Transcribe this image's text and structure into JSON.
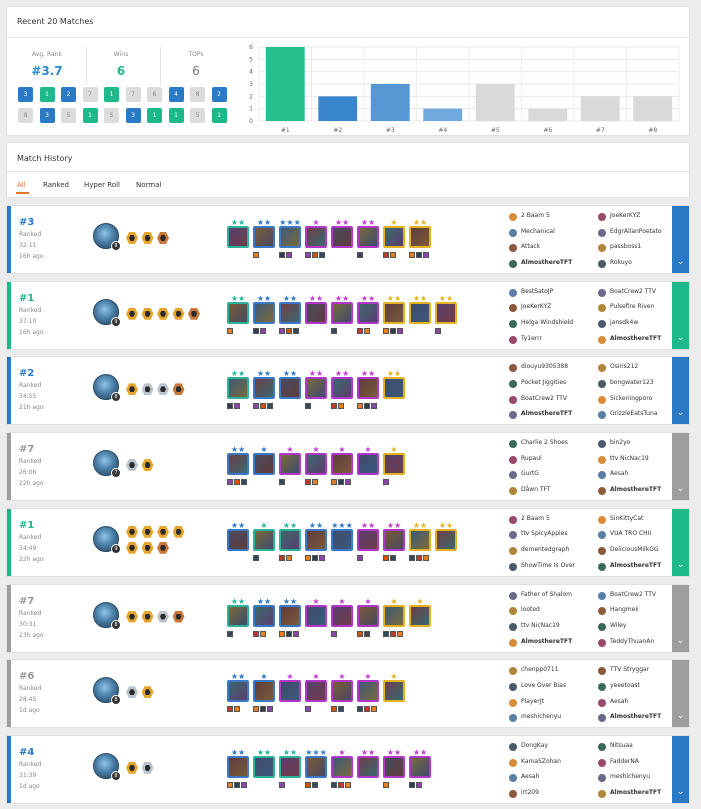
{
  "summary": {
    "title": "Recent 20 Matches",
    "stats": [
      {
        "label": "Avg. Rank",
        "value": "#3.7",
        "color": "#2a8acb"
      },
      {
        "label": "Wins",
        "value": "6",
        "color": "#1db98a"
      },
      {
        "label": "TOPs",
        "value": "6",
        "color": "#777777"
      }
    ],
    "placements_row1": [
      "3",
      "1",
      "2",
      "7",
      "1",
      "7",
      "6",
      "4",
      "8",
      "2"
    ],
    "placements_row2": [
      "8",
      "3",
      "5",
      "1",
      "5",
      "3",
      "1",
      "1",
      "5",
      "1"
    ]
  },
  "chart_data": {
    "type": "bar",
    "categories": [
      "#1",
      "#2",
      "#3",
      "#4",
      "#5",
      "#6",
      "#7",
      "#8"
    ],
    "values": [
      6,
      2,
      3,
      1,
      3,
      1,
      2,
      2
    ],
    "colors": [
      "#27c08f",
      "#3a86cd",
      "#5797d4",
      "#6fa9dd",
      "#d9d9d9",
      "#d9d9d9",
      "#d9d9d9",
      "#d9d9d9"
    ],
    "ylim": [
      0,
      6
    ],
    "yticks": [
      "0",
      "1",
      "2",
      "3",
      "4",
      "5",
      "6"
    ],
    "grid": true
  },
  "history": {
    "title": "Match History",
    "filters": [
      "All",
      "Ranked",
      "Hyper Roll",
      "Normal"
    ]
  },
  "colors": {
    "win": "#1db98a",
    "top": "#2a7ac6",
    "loss": "#9e9e9e",
    "trait_gold": "#e6a62e",
    "trait_silver": "#b8c3cc",
    "trait_bronze": "#c9783a"
  },
  "matches": [
    {
      "place": "#3",
      "type": "Ranked",
      "duration": "32:11",
      "ago": "16h ago",
      "result": "top",
      "level": "8",
      "traits": [
        "gold",
        "gold",
        "bronze"
      ],
      "units": [
        {
          "stars": "★★",
          "tier": "teal"
        },
        {
          "stars": "★★",
          "tier": "blue"
        },
        {
          "stars": "★★★",
          "tier": "blue"
        },
        {
          "stars": "★",
          "tier": "purple"
        },
        {
          "stars": "★★",
          "tier": "purple"
        },
        {
          "stars": "★★",
          "tier": "purple"
        },
        {
          "stars": "★",
          "tier": "gold"
        },
        {
          "stars": "★★",
          "tier": "gold"
        }
      ],
      "players_left": [
        "2 Baam 5",
        "Mechanical",
        "Attack",
        "AlmosthereTFT"
      ],
      "players_right": [
        "JoeKerKYZ",
        "EdgrAllanPoetato",
        "passboss1",
        "Rokuyo"
      ]
    },
    {
      "place": "#1",
      "type": "Ranked",
      "duration": "37:10",
      "ago": "16h ago",
      "result": "win",
      "level": "9",
      "traits": [
        "gold",
        "gold",
        "gold",
        "gold",
        "bronze"
      ],
      "units": [
        {
          "stars": "★★",
          "tier": "teal"
        },
        {
          "stars": "★★",
          "tier": "blue"
        },
        {
          "stars": "★★",
          "tier": "blue"
        },
        {
          "stars": "★★",
          "tier": "purple"
        },
        {
          "stars": "★★",
          "tier": "purple"
        },
        {
          "stars": "★★",
          "tier": "purple"
        },
        {
          "stars": "★★",
          "tier": "gold"
        },
        {
          "stars": "★★",
          "tier": "gold"
        },
        {
          "stars": "★★",
          "tier": "gold"
        }
      ],
      "players_left": [
        "BestSatoJP",
        "JoeKerKYZ",
        "Helga Windshield",
        "Ty1errr"
      ],
      "players_right": [
        "BoatCrew2 TTV",
        "Pulsefire Riven",
        "jansdk4w",
        "AlmosthereTFT"
      ]
    },
    {
      "place": "#2",
      "type": "Ranked",
      "duration": "34:55",
      "ago": "21h ago",
      "result": "top",
      "level": "8",
      "traits": [
        "gold",
        "silver",
        "silver",
        "bronze"
      ],
      "units": [
        {
          "stars": "★★",
          "tier": "teal"
        },
        {
          "stars": "★★",
          "tier": "blue"
        },
        {
          "stars": "★★",
          "tier": "blue"
        },
        {
          "stars": "★★",
          "tier": "purple"
        },
        {
          "stars": "★★",
          "tier": "purple"
        },
        {
          "stars": "★★",
          "tier": "purple"
        },
        {
          "stars": "★★",
          "tier": "gold"
        }
      ],
      "players_left": [
        "diouyu9305388",
        "Pocket Jiggities",
        "BoatCrew2 TTV",
        "AlmosthereTFT"
      ],
      "players_right": [
        "Osiris212",
        "bongwater123",
        "Sickeningporo",
        "GrizzleEatsTuna"
      ]
    },
    {
      "place": "#7",
      "type": "Ranked",
      "duration": "26:06",
      "ago": "22h ago",
      "result": "loss",
      "level": "7",
      "traits": [
        "silver",
        "gold"
      ],
      "units": [
        {
          "stars": "★★",
          "tier": "blue"
        },
        {
          "stars": "★",
          "tier": "blue"
        },
        {
          "stars": "★",
          "tier": "purple"
        },
        {
          "stars": "★",
          "tier": "purple"
        },
        {
          "stars": "★",
          "tier": "purple"
        },
        {
          "stars": "★",
          "tier": "purple"
        },
        {
          "stars": "★",
          "tier": "gold"
        }
      ],
      "players_left": [
        "Charlie 2 Shoes",
        "Rupaul",
        "GurtG",
        "Dåwn TFT"
      ],
      "players_right": [
        "bin2yo",
        "ttv NicNac19",
        "Aesah",
        "AlmosthereTFT"
      ]
    },
    {
      "place": "#1",
      "type": "Ranked",
      "duration": "34:49",
      "ago": "22h ago",
      "result": "win",
      "level": "9",
      "traits": [
        "gold",
        "gold",
        "gold",
        "gold",
        "gold",
        "gold",
        "bronze"
      ],
      "units": [
        {
          "stars": "★★",
          "tier": "blue"
        },
        {
          "stars": "★",
          "tier": "teal"
        },
        {
          "stars": "★★",
          "tier": "teal"
        },
        {
          "stars": "★★",
          "tier": "blue"
        },
        {
          "stars": "★★★",
          "tier": "blue"
        },
        {
          "stars": "★★",
          "tier": "purple"
        },
        {
          "stars": "★★",
          "tier": "purple"
        },
        {
          "stars": "★★",
          "tier": "gold"
        },
        {
          "stars": "★★",
          "tier": "gold"
        }
      ],
      "players_left": [
        "2 Baam 5",
        "ttv SpicyApples",
        "dementedgraph",
        "ShowTime Is Over"
      ],
      "players_right": [
        "SinKittyCat",
        "VUA TRO CHII",
        "DeliciousMilkGG",
        "AlmosthereTFT"
      ]
    },
    {
      "place": "#7",
      "type": "Ranked",
      "duration": "30:31",
      "ago": "23h ago",
      "result": "loss",
      "level": "8",
      "traits": [
        "gold",
        "gold",
        "silver",
        "bronze"
      ],
      "units": [
        {
          "stars": "★★",
          "tier": "teal"
        },
        {
          "stars": "★★",
          "tier": "blue"
        },
        {
          "stars": "★★",
          "tier": "blue"
        },
        {
          "stars": "★",
          "tier": "purple"
        },
        {
          "stars": "★",
          "tier": "purple"
        },
        {
          "stars": "★",
          "tier": "purple"
        },
        {
          "stars": "★",
          "tier": "gold"
        },
        {
          "stars": "★",
          "tier": "gold"
        }
      ],
      "players_left": [
        "Father of Shalom",
        "looted",
        "ttv NicNac19",
        "AlmosthereTFT"
      ],
      "players_right": [
        "BoatCrew2 TTV",
        "Hangmeii",
        "Wiley",
        "TeddyThuanAn"
      ]
    },
    {
      "place": "#6",
      "type": "Ranked",
      "duration": "28:45",
      "ago": "1d ago",
      "result": "loss",
      "level": "8",
      "traits": [
        "silver",
        "gold"
      ],
      "units": [
        {
          "stars": "★★",
          "tier": "blue"
        },
        {
          "stars": "★",
          "tier": "blue"
        },
        {
          "stars": "★",
          "tier": "purple"
        },
        {
          "stars": "★",
          "tier": "purple"
        },
        {
          "stars": "★",
          "tier": "purple"
        },
        {
          "stars": "★",
          "tier": "purple"
        },
        {
          "stars": "★",
          "tier": "gold"
        }
      ],
      "players_left": [
        "chenpp0711",
        "Love Over Bias",
        "PlayerJt",
        "meshichenyu"
      ],
      "players_right": [
        "TTV Stryggar",
        "yeeetoast",
        "Aesah",
        "AlmosthereTFT"
      ]
    },
    {
      "place": "#4",
      "type": "Ranked",
      "duration": "31:39",
      "ago": "1d ago",
      "result": "top",
      "level": "8",
      "traits": [
        "gold",
        "silver"
      ],
      "units": [
        {
          "stars": "★★",
          "tier": "blue"
        },
        {
          "stars": "★★",
          "tier": "teal"
        },
        {
          "stars": "★★",
          "tier": "teal"
        },
        {
          "stars": "★★★",
          "tier": "blue"
        },
        {
          "stars": "★",
          "tier": "purple"
        },
        {
          "stars": "★★",
          "tier": "purple"
        },
        {
          "stars": "★★",
          "tier": "purple"
        },
        {
          "stars": "★★",
          "tier": "purple"
        }
      ],
      "players_left": [
        "DongKay",
        "KamaSZohan",
        "Aesah",
        "irt209"
      ],
      "players_right": [
        "Nitsuaa",
        "FadderNA",
        "meshichenyu",
        "AlmosthereTFT"
      ]
    }
  ],
  "self_name": "AlmosthereTFT",
  "icons": {
    "expand": "chevron-down-icon"
  }
}
